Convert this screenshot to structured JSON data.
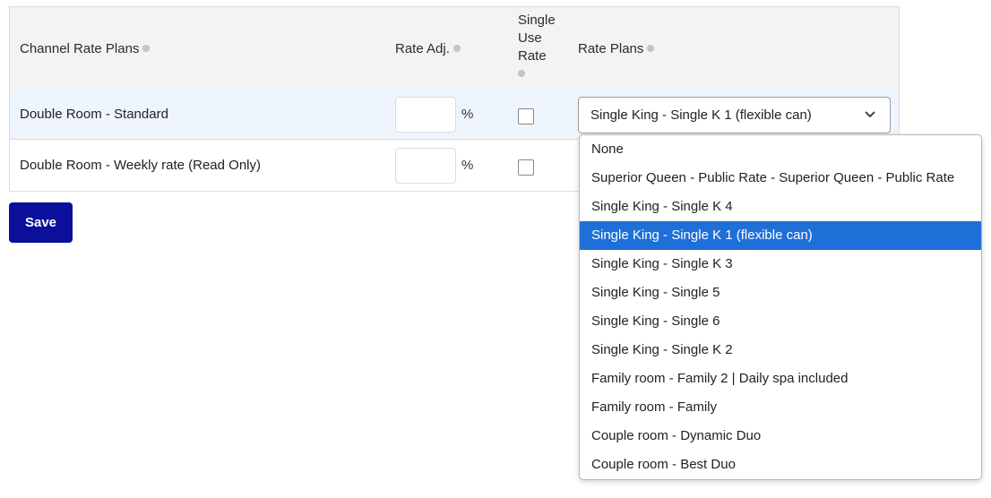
{
  "table": {
    "headers": {
      "channel_rate_plans": "Channel Rate Plans",
      "rate_adj": "Rate Adj.",
      "single_use_rate_line1": "Single",
      "single_use_rate_line2": "Use",
      "single_use_rate_line3": "Rate",
      "rate_plans": "Rate Plans"
    },
    "rows": [
      {
        "name": "Double Room - Standard",
        "rate_adj_value": "",
        "percent_symbol": "%",
        "single_use_checked": false,
        "rate_plan_selected": "Single King - Single K 1 (flexible can)"
      },
      {
        "name": "Double Room - Weekly rate (Read Only)",
        "rate_adj_value": "",
        "percent_symbol": "%",
        "single_use_checked": false
      }
    ]
  },
  "save_label": "Save",
  "dropdown": {
    "options": [
      "None",
      "Superior Queen - Public Rate - Superior Queen - Public Rate",
      "Single King - Single K 4",
      "Single King - Single K 1 (flexible can)",
      "Single King - Single K 3",
      "Single King - Single 5",
      "Single King - Single 6",
      "Single King - Single K 2",
      "Family room - Family 2 | Daily spa included",
      "Family room - Family",
      "Couple room - Dynamic Duo",
      "Couple room - Best Duo"
    ],
    "selected_index": 3
  },
  "colors": {
    "accent": "#0a0f9c",
    "selected_option": "#1f6fd8",
    "row_highlight": "#eef5fc",
    "header_bg": "#f3f3f3"
  }
}
